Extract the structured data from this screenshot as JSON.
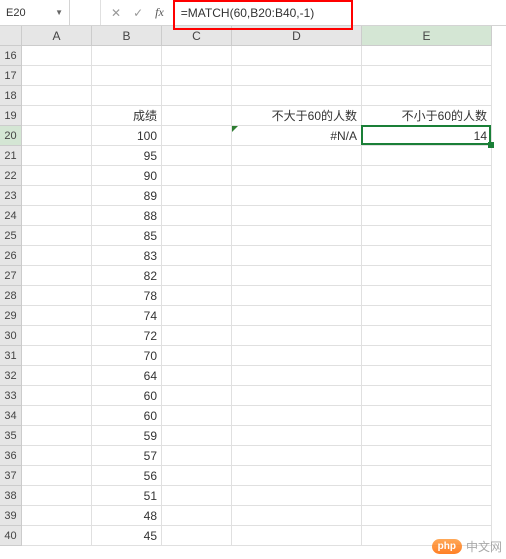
{
  "nameBox": "E20",
  "formulaBar": {
    "cancel": "✕",
    "confirm": "✓",
    "fx": "fx",
    "formula": "=MATCH(60,B20:B40,-1)"
  },
  "columns": [
    "A",
    "B",
    "C",
    "D",
    "E"
  ],
  "rowStart": 16,
  "rowEnd": 40,
  "activeCol": "E",
  "activeRow": 20,
  "cells": {
    "B19": "成绩",
    "D19": "不大于60的人数",
    "E19": "不小于60的人数",
    "D20": "#N/A",
    "E20": "14",
    "B20": "100",
    "B21": "95",
    "B22": "90",
    "B23": "89",
    "B24": "88",
    "B25": "85",
    "B26": "83",
    "B27": "82",
    "B28": "78",
    "B29": "74",
    "B30": "72",
    "B31": "70",
    "B32": "64",
    "B33": "60",
    "B34": "60",
    "B35": "59",
    "B36": "57",
    "B37": "56",
    "B38": "51",
    "B39": "48",
    "B40": "45"
  },
  "watermark": {
    "badge": "php",
    "text": "中文网"
  }
}
